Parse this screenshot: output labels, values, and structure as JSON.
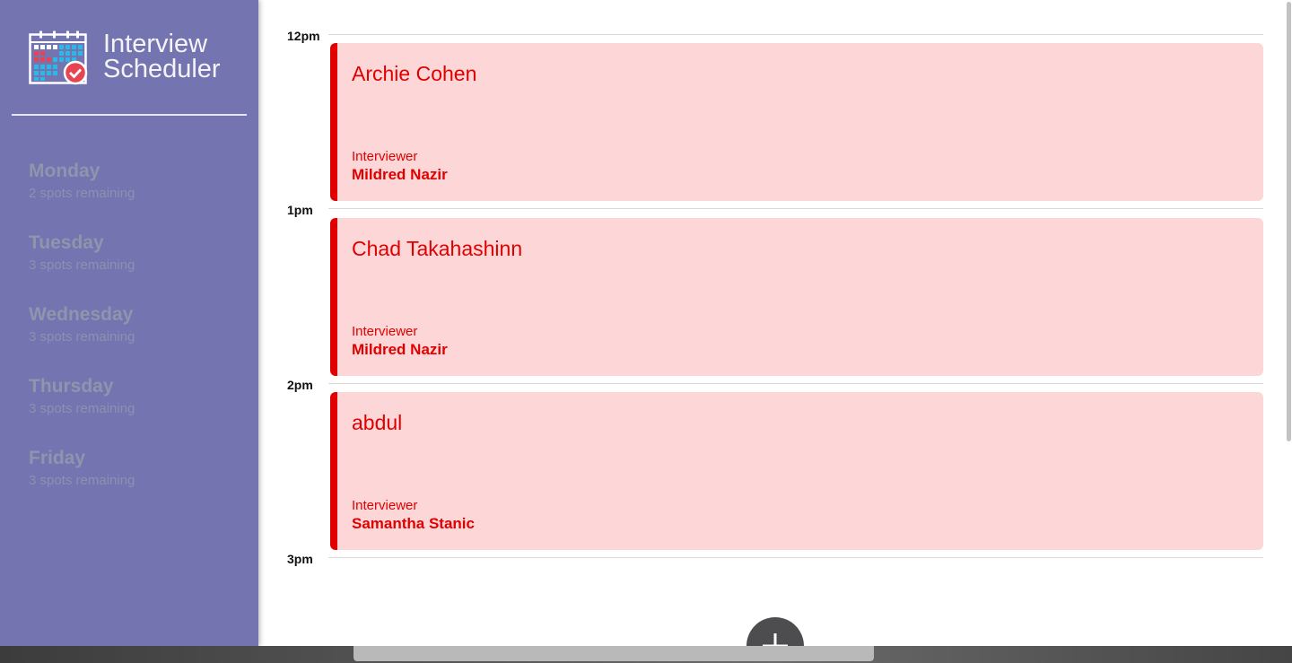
{
  "brand": {
    "title_line1": "Interview",
    "title_line2": "Scheduler",
    "logo_icon": "calendar-check-icon"
  },
  "days": [
    {
      "name": "Monday",
      "spots": "2 spots remaining"
    },
    {
      "name": "Tuesday",
      "spots": "3 spots remaining"
    },
    {
      "name": "Wednesday",
      "spots": "3 spots remaining"
    },
    {
      "name": "Thursday",
      "spots": "3 spots remaining"
    },
    {
      "name": "Friday",
      "spots": "3 spots remaining"
    }
  ],
  "schedule": {
    "times": [
      "12pm",
      "1pm",
      "2pm",
      "3pm"
    ],
    "appointments": [
      {
        "student": "Archie Cohen",
        "interviewer_label": "Interviewer",
        "interviewer": "Mildred Nazir"
      },
      {
        "student": "Chad Takahashinn",
        "interviewer_label": "Interviewer",
        "interviewer": "Mildred Nazir"
      },
      {
        "student": "abdul",
        "interviewer_label": "Interviewer",
        "interviewer": "Samantha Stanic"
      }
    ],
    "add_icon": "plus-icon"
  },
  "colors": {
    "sidebar": "#7474b0",
    "appointment_bg": "#fdd7d8",
    "appointment_accent": "#e00000",
    "add_button": "#4d4d4f"
  }
}
